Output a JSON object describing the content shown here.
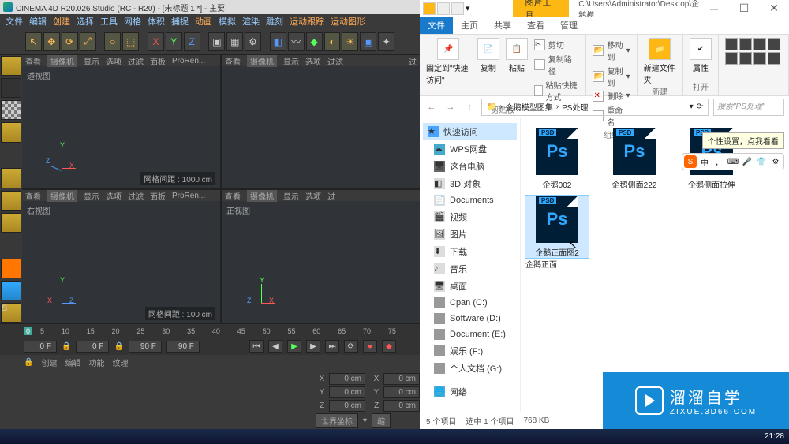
{
  "c4d": {
    "title": "CINEMA 4D R20.026 Studio (RC - R20) - [未标题 1 *] - 主要",
    "menu": [
      "文件",
      "编辑",
      "创建",
      "选择",
      "工具",
      "网格",
      "体积",
      "捕捉",
      "动画",
      "模拟",
      "渲染",
      "雕刻",
      "运动跟踪",
      "运动图形"
    ],
    "xyz": [
      "X",
      "Y",
      "Z"
    ],
    "viewports": {
      "head": {
        "see": "查看",
        "cam": "摄像机",
        "disp": "显示",
        "opt": "选项",
        "filt": "过滤",
        "panel": "面板",
        "renderer": "ProRen..."
      },
      "persp": {
        "label": "透视图",
        "grid": "网格间距 : 1000 cm"
      },
      "right": {
        "label": "右视图",
        "grid": "网格间距 : 100 cm"
      },
      "front": {
        "label": "正视图"
      }
    },
    "timeline": {
      "ticks": [
        "0",
        "5",
        "10",
        "15",
        "20",
        "25",
        "30",
        "35",
        "40",
        "45",
        "50",
        "55",
        "60",
        "65",
        "70",
        "75"
      ]
    },
    "playbar": {
      "start": "0 F",
      "a": "0 F",
      "b": "90 F",
      "end": "90 F"
    },
    "attr": {
      "create": "创建",
      "edit": "编辑",
      "func": "功能",
      "tex": "纹理"
    },
    "coords": {
      "x": {
        "lbl": "X",
        "val": "0 cm"
      },
      "y": {
        "lbl": "Y",
        "val": "0 cm"
      },
      "z": {
        "lbl": "Z",
        "val": "0 cm"
      },
      "space": "世界坐标",
      "scale": "缩"
    }
  },
  "explorer": {
    "titletab": "图片工具",
    "titlepath": "C:\\Users\\Administrator\\Desktop\\企鹅模...",
    "tabs": {
      "file": "文件",
      "home": "主页",
      "share": "共享",
      "view": "查看",
      "manage": "管理"
    },
    "ribbon": {
      "pin": {
        "pin": "固定到\"快速访问\"",
        "copy": "复制",
        "paste": "粘贴",
        "cut": "剪切",
        "copypath": "复制路径",
        "pastesc": "粘贴快捷方式",
        "group": "剪贴板"
      },
      "org": {
        "move": "移动到",
        "copyto": "复制到",
        "del": "删除",
        "rename": "重命名",
        "group": "组织"
      },
      "new": {
        "folder": "新建文件夹",
        "group": "新建"
      },
      "open": {
        "props": "属性",
        "group": "打开"
      }
    },
    "breadcrumb": {
      "a": "企鹅模型图集",
      "b": "PS处理"
    },
    "search": "搜索\"PS处理\"",
    "nav": {
      "quick": "快速访问",
      "wps": "WPS网盘",
      "thispc": "这台电脑",
      "obj3d": "3D 对象",
      "docs": "Documents",
      "video": "视频",
      "pics": "图片",
      "down": "下载",
      "music": "音乐",
      "desk": "桌面",
      "c": "Cpan (C:)",
      "d": "Software (D:)",
      "e": "Document (E:)",
      "f": "娱乐 (F:)",
      "g": "个人文档 (G:)",
      "net": "网络"
    },
    "files": {
      "f1": "企鹅002",
      "f2": "企鹅侧面222",
      "f3": "企鹅侧面拉伸",
      "f4": "企鹅正面",
      "sel": "企鹅正面图2",
      "psd": "PSD",
      "ps": "Ps"
    },
    "tooltip": "个性设置，点我看看",
    "ime": "中",
    "status": {
      "count": "5 个项目",
      "sel": "选中 1 个项目",
      "size": "768 KB"
    }
  },
  "logo": {
    "cn": "溜溜自学",
    "en": "ZIXUE.3D66.COM"
  },
  "taskbar": {
    "clock": "21:28"
  }
}
